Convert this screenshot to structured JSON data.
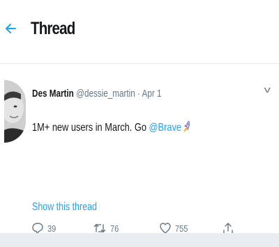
{
  "header": {
    "title": "Thread"
  },
  "tweet": {
    "author_name": "Des Martin",
    "author_handle": "@dessie_martin",
    "separator": " · ",
    "date": "Apr 1",
    "text_before": "1M+ new users in March. Go ",
    "mention": "@Brave",
    "emoji": "rocket-icon"
  },
  "actions": {
    "replies": "39",
    "retweets": "76",
    "likes": "755"
  },
  "links": {
    "show_thread": "Show this thread"
  },
  "colors": {
    "accent": "#1da1f2",
    "muted": "#657786",
    "border": "#e6ecf0"
  }
}
